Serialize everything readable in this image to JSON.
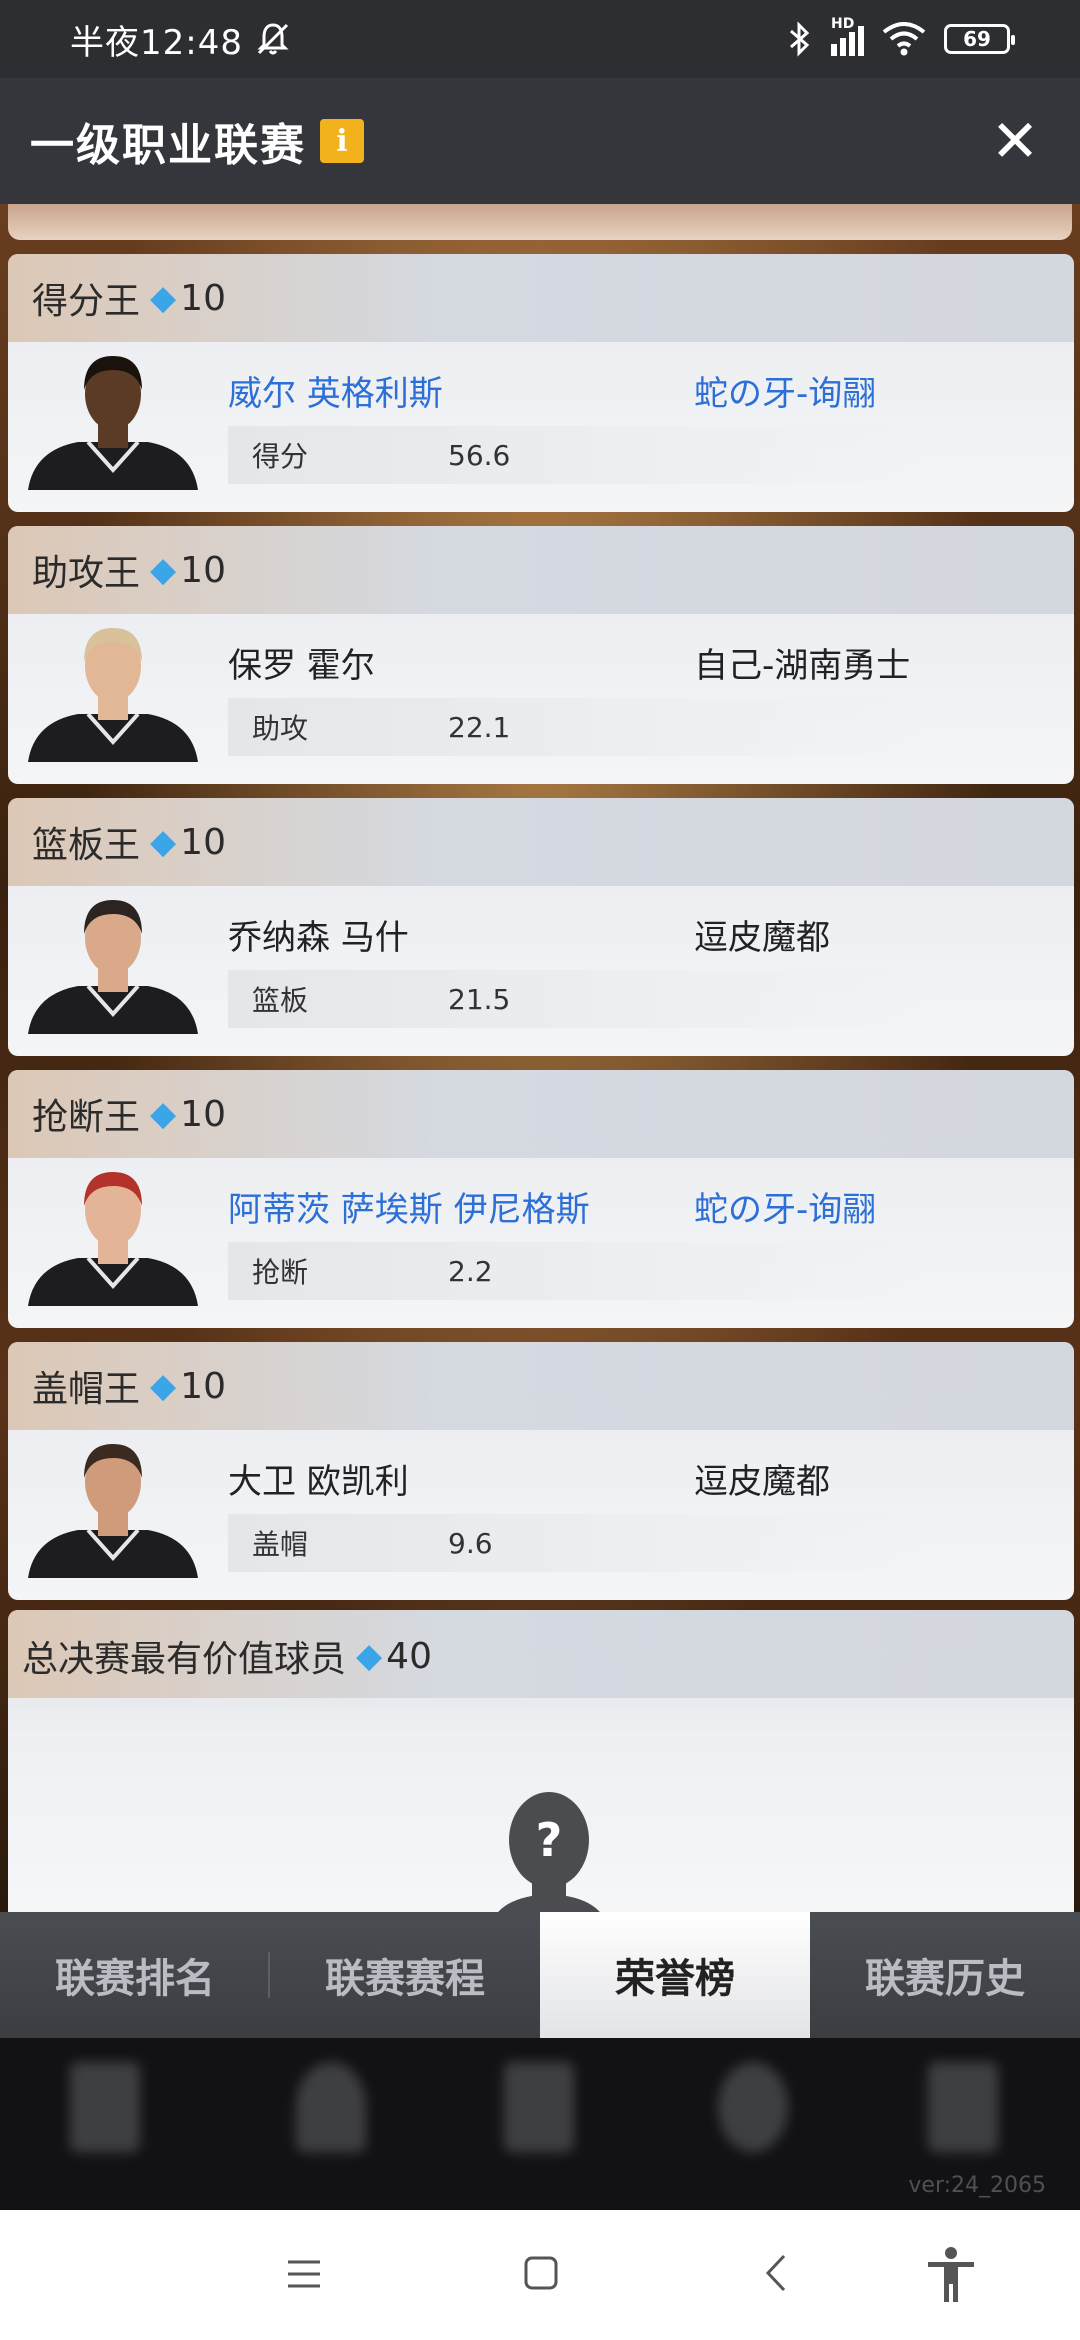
{
  "status_bar": {
    "time": "半夜12:48",
    "battery": "69",
    "hd_label": "HD"
  },
  "header": {
    "title": "一级职业联赛",
    "info_badge": "i",
    "close_label": "✕"
  },
  "awards": [
    {
      "title": "得分王",
      "reward": "10",
      "player": "威尔 英格利斯",
      "team": "蛇の牙-询翮",
      "highlight": true,
      "stat_label": "得分",
      "stat_value": "56.6",
      "hair_color": "#1a120c",
      "skin_color": "#5b3a26"
    },
    {
      "title": "助攻王",
      "reward": "10",
      "player": "保罗 霍尔",
      "team": "自己-湖南勇士",
      "highlight": false,
      "stat_label": "助攻",
      "stat_value": "22.1",
      "hair_color": "#d9c29a",
      "skin_color": "#e2b796"
    },
    {
      "title": "篮板王",
      "reward": "10",
      "player": "乔纳森 马什",
      "team": "逗皮魔都",
      "highlight": false,
      "stat_label": "篮板",
      "stat_value": "21.5",
      "hair_color": "#2b2420",
      "skin_color": "#d9a98a"
    },
    {
      "title": "抢断王",
      "reward": "10",
      "player": "阿蒂茨 萨埃斯 伊尼格斯",
      "team": "蛇の牙-询翮",
      "highlight": true,
      "stat_label": "抢断",
      "stat_value": "2.2",
      "hair_color": "#b3322a",
      "skin_color": "#e3b497"
    },
    {
      "title": "盖帽王",
      "reward": "10",
      "player": "大卫 欧凯利",
      "team": "逗皮魔都",
      "highlight": false,
      "stat_label": "盖帽",
      "stat_value": "9.6",
      "hair_color": "#3a2a20",
      "skin_color": "#cf9b7a"
    }
  ],
  "mvp": {
    "title": "总决赛最有价值球员",
    "reward": "40",
    "placeholder_glyph": "?"
  },
  "tabs": [
    {
      "label": "联赛排名",
      "active": false
    },
    {
      "label": "联赛赛程",
      "active": false
    },
    {
      "label": "荣誉榜",
      "active": true
    },
    {
      "label": "联赛历史",
      "active": false
    }
  ],
  "version": "ver:24_2065",
  "colors": {
    "accent_blue": "#2c6fd6",
    "diamond": "#3aa6e8",
    "info_badge": "#f2b21b"
  }
}
